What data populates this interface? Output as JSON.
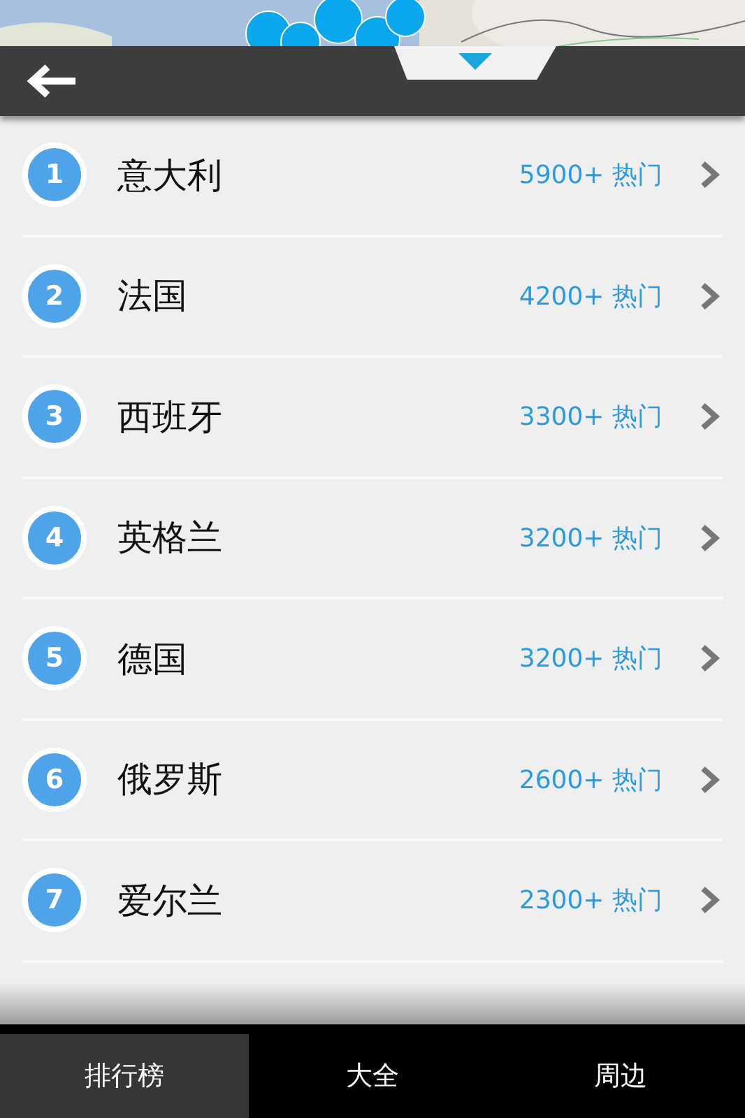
{
  "list": [
    {
      "rank": "1",
      "name": "意大利",
      "count": "5900+ 热门"
    },
    {
      "rank": "2",
      "name": "法国",
      "count": "4200+ 热门"
    },
    {
      "rank": "3",
      "name": "西班牙",
      "count": "3300+ 热门"
    },
    {
      "rank": "4",
      "name": "英格兰",
      "count": "3200+ 热门"
    },
    {
      "rank": "5",
      "name": "德国",
      "count": "3200+ 热门"
    },
    {
      "rank": "6",
      "name": "俄罗斯",
      "count": "2600+ 热门"
    },
    {
      "rank": "7",
      "name": "爱尔兰",
      "count": "2300+ 热门"
    }
  ],
  "tabs": [
    {
      "label": "排行榜",
      "selected": true
    },
    {
      "label": "大全",
      "selected": false
    },
    {
      "label": "周边",
      "selected": false
    }
  ]
}
